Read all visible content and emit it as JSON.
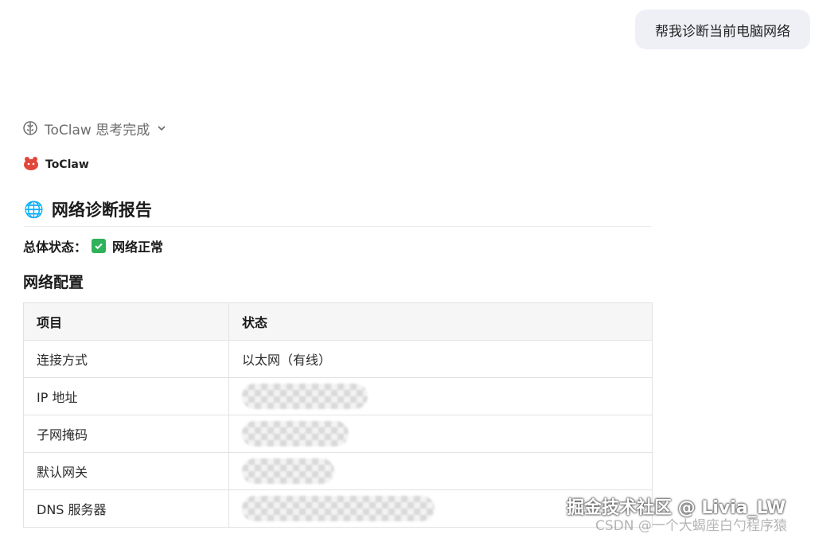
{
  "user_message": "帮我诊断当前电脑网络",
  "thinking": {
    "label": "ToClaw 思考完成"
  },
  "agent": {
    "name": "ToClaw"
  },
  "report": {
    "emoji": "🌐",
    "title": "网络诊断报告",
    "overall_label": "总体状态：",
    "overall_value": "网络正常",
    "section_title": "网络配置",
    "table": {
      "headers": [
        "项目",
        "状态"
      ],
      "rows": [
        {
          "item": "连接方式",
          "status": "以太网（有线）"
        },
        {
          "item": "IP 地址",
          "status": ""
        },
        {
          "item": "子网掩码",
          "status": ""
        },
        {
          "item": "默认网关",
          "status": ""
        },
        {
          "item": "DNS 服务器",
          "status": ""
        }
      ]
    }
  },
  "watermarks": {
    "primary": "掘金技术社区 @ Livia_LW",
    "secondary": "CSDN @一个大蝎座白勺程序猿"
  },
  "colors": {
    "check": "#2fb25a",
    "bubble": "#eef0f6"
  }
}
